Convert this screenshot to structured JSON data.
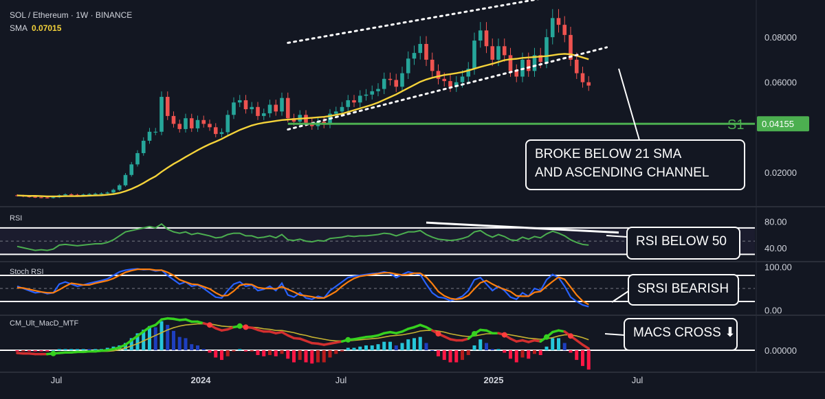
{
  "header": {
    "symbol": "SOL / Ethereum · 1W · BINANCE",
    "sma_label": "SMA",
    "sma_value": "0.07015"
  },
  "panes": {
    "rsi_label": "RSI",
    "stoch_label": "Stoch RSI",
    "macd_label": "CM_Ult_MacD_MTF"
  },
  "colors": {
    "background": "#131722",
    "up": "#26a69a",
    "down": "#ef5350",
    "sma": "#f5d33a",
    "support": "#4caf50",
    "rsi": "#4caf50",
    "stoch_k": "#2962ff",
    "stoch_d": "#ff7f0e"
  },
  "annotations": {
    "price_callout": [
      "BROKE BELOW 21 SMA",
      "AND ASCENDING CHANNEL"
    ],
    "rsi_callout": "RSI BELOW 50",
    "stoch_callout": "SRSI BEARISH",
    "macd_callout": "MACS CROSS",
    "macd_callout_icon": "down-arrow-icon",
    "support_label": "S1",
    "support_value": "0.04155"
  },
  "chart_data": {
    "type": "candlestick",
    "x_ticks": [
      "Jul",
      "2024",
      "Jul",
      "2025",
      "Jul"
    ],
    "price_axis": {
      "ticks": [
        "0.08000",
        "0.06000",
        "0.02000"
      ],
      "ylim": [
        0.005,
        0.095
      ]
    },
    "current_price_label": "0.04155",
    "support_level": 0.04155,
    "sma_period": 21,
    "sma_last": 0.07015,
    "rsi_axis": {
      "ticks": [
        "80.00",
        "40.00"
      ],
      "ylim": [
        20,
        100
      ],
      "bands": [
        30,
        50,
        70
      ]
    },
    "stoch_axis": {
      "ticks": [
        "100.00",
        "0.00"
      ],
      "ylim": [
        -10,
        110
      ],
      "bands": [
        20,
        50,
        80
      ]
    },
    "macd_axis": {
      "ticks": [
        "0.00000"
      ]
    },
    "closes": [
      0.0096,
      0.0093,
      0.0091,
      0.0089,
      0.0088,
      0.0087,
      0.0089,
      0.0098,
      0.0102,
      0.01,
      0.0099,
      0.0101,
      0.0103,
      0.0105,
      0.0106,
      0.011,
      0.0122,
      0.0142,
      0.0188,
      0.0235,
      0.0285,
      0.034,
      0.038,
      0.038,
      0.0535,
      0.045,
      0.0415,
      0.0392,
      0.044,
      0.0395,
      0.0432,
      0.0415,
      0.04,
      0.037,
      0.0378,
      0.0455,
      0.051,
      0.052,
      0.048,
      0.049,
      0.045,
      0.0462,
      0.05,
      0.047,
      0.053,
      0.044,
      0.0425,
      0.0455,
      0.042,
      0.0405,
      0.0425,
      0.0412,
      0.046,
      0.047,
      0.049,
      0.052,
      0.051,
      0.054,
      0.0545,
      0.056,
      0.057,
      0.0615,
      0.061,
      0.058,
      0.064,
      0.0705,
      0.073,
      0.077,
      0.07,
      0.065,
      0.0615,
      0.0605,
      0.058,
      0.06,
      0.0625,
      0.066,
      0.0785,
      0.083,
      0.076,
      0.07,
      0.076,
      0.072,
      0.065,
      0.0625,
      0.07,
      0.065,
      0.072,
      0.069,
      0.08,
      0.0885,
      0.0855,
      0.081,
      0.07,
      0.064,
      0.06,
      0.0585
    ],
    "sma_values": [
      0.0097,
      0.0096,
      0.0095,
      0.0095,
      0.0094,
      0.0093,
      0.0093,
      0.0093,
      0.0094,
      0.0094,
      0.0094,
      0.0095,
      0.0096,
      0.0097,
      0.0098,
      0.01,
      0.0103,
      0.0108,
      0.0116,
      0.0126,
      0.0138,
      0.0152,
      0.0168,
      0.0182,
      0.0202,
      0.022,
      0.0237,
      0.0252,
      0.0268,
      0.0283,
      0.0298,
      0.0312,
      0.0325,
      0.0336,
      0.0348,
      0.0362,
      0.0375,
      0.0388,
      0.0398,
      0.0408,
      0.0415,
      0.042,
      0.0424,
      0.0428,
      0.0432,
      0.0434,
      0.0436,
      0.0438,
      0.044,
      0.0442,
      0.0444,
      0.0446,
      0.045,
      0.0455,
      0.046,
      0.0468,
      0.0476,
      0.0484,
      0.0492,
      0.05,
      0.051,
      0.0522,
      0.0534,
      0.0546,
      0.056,
      0.0574,
      0.0588,
      0.0602,
      0.0612,
      0.062,
      0.0626,
      0.0632,
      0.0636,
      0.064,
      0.0645,
      0.0652,
      0.066,
      0.0668,
      0.0675,
      0.0682,
      0.069,
      0.0698,
      0.0702,
      0.0704,
      0.0708,
      0.071,
      0.0712,
      0.0714,
      0.0716,
      0.072,
      0.0724,
      0.0726,
      0.0724,
      0.0718,
      0.071,
      0.0702
    ],
    "rsi_values": [
      42,
      40,
      38,
      36,
      37,
      36,
      38,
      44,
      45,
      44,
      43,
      44,
      45,
      46,
      46,
      48,
      52,
      58,
      64,
      66,
      68,
      70,
      72,
      70,
      76,
      68,
      64,
      62,
      64,
      60,
      62,
      60,
      58,
      55,
      56,
      60,
      62,
      62,
      58,
      58,
      55,
      56,
      58,
      55,
      60,
      52,
      51,
      53,
      50,
      49,
      51,
      50,
      54,
      55,
      56,
      58,
      57,
      58,
      58,
      59,
      60,
      62,
      61,
      58,
      61,
      64,
      64,
      66,
      60,
      56,
      53,
      52,
      51,
      52,
      54,
      57,
      64,
      66,
      60,
      56,
      60,
      57,
      52,
      51,
      56,
      53,
      57,
      55,
      61,
      65,
      62,
      58,
      52,
      48,
      45,
      44
    ],
    "stoch_k": [
      55,
      50,
      45,
      40,
      42,
      38,
      40,
      60,
      65,
      60,
      55,
      58,
      62,
      65,
      68,
      72,
      80,
      88,
      92,
      94,
      95,
      93,
      94,
      90,
      92,
      80,
      70,
      60,
      65,
      55,
      58,
      50,
      40,
      30,
      28,
      45,
      60,
      65,
      55,
      58,
      45,
      48,
      55,
      45,
      62,
      35,
      30,
      40,
      28,
      25,
      32,
      28,
      45,
      55,
      65,
      75,
      78,
      80,
      82,
      84,
      85,
      88,
      85,
      75,
      82,
      88,
      85,
      82,
      60,
      40,
      30,
      28,
      22,
      26,
      32,
      45,
      70,
      75,
      60,
      45,
      55,
      45,
      30,
      25,
      40,
      32,
      50,
      45,
      70,
      82,
      75,
      55,
      30,
      20,
      12,
      8
    ],
    "stoch_d": [
      52,
      51,
      48,
      45,
      42,
      40,
      40,
      47,
      55,
      62,
      60,
      58,
      58,
      62,
      65,
      68,
      73,
      80,
      87,
      91,
      94,
      94,
      94,
      92,
      92,
      87,
      80,
      70,
      65,
      60,
      59,
      54,
      49,
      40,
      33,
      34,
      44,
      57,
      60,
      59,
      52,
      50,
      50,
      49,
      54,
      48,
      42,
      35,
      33,
      31,
      28,
      28,
      35,
      43,
      55,
      65,
      73,
      78,
      80,
      82,
      84,
      86,
      86,
      83,
      81,
      82,
      85,
      85,
      76,
      61,
      43,
      33,
      27,
      25,
      27,
      34,
      49,
      63,
      68,
      60,
      53,
      48,
      43,
      33,
      32,
      32,
      41,
      43,
      55,
      66,
      76,
      71,
      53,
      35,
      21,
      13
    ],
    "macd_values": [
      -0.0005,
      -0.0006,
      -0.0006,
      -0.0007,
      -0.0007,
      -0.0007,
      -0.0006,
      -0.0005,
      -0.0004,
      -0.0004,
      -0.0003,
      -0.0003,
      -0.0002,
      -0.0002,
      -0.0001,
      0.0,
      0.0002,
      0.0005,
      0.001,
      0.0018,
      0.0026,
      0.0034,
      0.0042,
      0.0046,
      0.0056,
      0.0058,
      0.0057,
      0.0055,
      0.0056,
      0.0052,
      0.0052,
      0.0049,
      0.0046,
      0.004,
      0.0036,
      0.0038,
      0.0042,
      0.0044,
      0.0042,
      0.0041,
      0.0037,
      0.0034,
      0.0034,
      0.0031,
      0.0033,
      0.0027,
      0.0022,
      0.0021,
      0.0017,
      0.0013,
      0.0012,
      0.001,
      0.0012,
      0.0014,
      0.0016,
      0.0019,
      0.002,
      0.0022,
      0.0024,
      0.0025,
      0.0027,
      0.0031,
      0.0033,
      0.0031,
      0.0034,
      0.0039,
      0.0042,
      0.0046,
      0.0042,
      0.0036,
      0.003,
      0.0025,
      0.002,
      0.0018,
      0.0018,
      0.0021,
      0.003,
      0.0037,
      0.0036,
      0.0031,
      0.0031,
      0.0028,
      0.0021,
      0.0016,
      0.0018,
      0.0015,
      0.0018,
      0.0016,
      0.0024,
      0.0033,
      0.0036,
      0.0034,
      0.0026,
      0.0018,
      0.001,
      0.0003
    ],
    "macd_signal": [
      -0.0004,
      -0.0005,
      -0.0005,
      -0.0006,
      -0.0006,
      -0.0006,
      -0.0006,
      -0.0006,
      -0.0005,
      -0.0005,
      -0.0004,
      -0.0004,
      -0.0003,
      -0.0003,
      -0.0002,
      -0.0002,
      -0.0001,
      0.0001,
      0.0004,
      0.0008,
      0.0012,
      0.0017,
      0.0022,
      0.0027,
      0.0032,
      0.0037,
      0.0041,
      0.0044,
      0.0046,
      0.0047,
      0.0048,
      0.0048,
      0.0048,
      0.0046,
      0.0044,
      0.0043,
      0.0043,
      0.0043,
      0.0043,
      0.0042,
      0.0041,
      0.0039,
      0.0038,
      0.0036,
      0.0036,
      0.0034,
      0.0032,
      0.0029,
      0.0027,
      0.0024,
      0.0022,
      0.002,
      0.0018,
      0.0017,
      0.0017,
      0.0017,
      0.0018,
      0.0019,
      0.002,
      0.0021,
      0.0022,
      0.0024,
      0.0026,
      0.0027,
      0.0028,
      0.003,
      0.0032,
      0.0035,
      0.0036,
      0.0036,
      0.0035,
      0.0033,
      0.003,
      0.0028,
      0.0026,
      0.0025,
      0.0026,
      0.0028,
      0.003,
      0.003,
      0.003,
      0.003,
      0.0028,
      0.0026,
      0.0024,
      0.0022,
      0.0021,
      0.002,
      0.0021,
      0.0023,
      0.0026,
      0.0028,
      0.0028,
      0.0026,
      0.0023,
      0.0019
    ],
    "channel": {
      "upper_start": [
        0.0775,
        45
      ],
      "upper_end": [
        0.0985,
        90
      ],
      "lower_start": [
        0.039,
        45
      ],
      "lower_end": [
        0.0755,
        98
      ]
    }
  }
}
